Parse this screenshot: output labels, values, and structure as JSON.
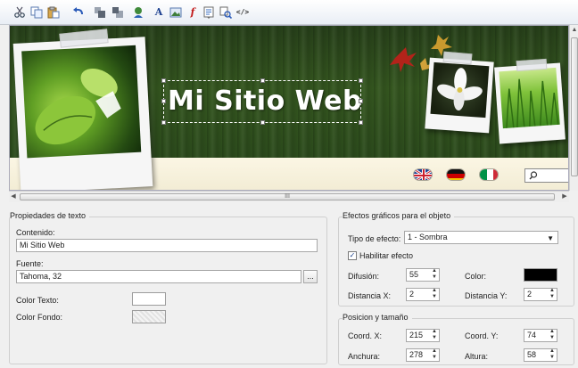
{
  "toolbar": {
    "buttons": [
      {
        "icon": "cut-icon"
      },
      {
        "icon": "copy-icon"
      },
      {
        "icon": "paste-icon"
      },
      {
        "icon": "undo-icon"
      },
      {
        "icon": "bring-forward-icon"
      },
      {
        "icon": "send-backward-icon"
      },
      {
        "icon": "clip-art-icon"
      },
      {
        "icon": "text-icon",
        "glyph": "A"
      },
      {
        "icon": "image-icon"
      },
      {
        "icon": "flash-icon",
        "glyph": "f"
      },
      {
        "icon": "properties-icon"
      },
      {
        "icon": "zoom-icon"
      },
      {
        "icon": "html-code-icon",
        "glyph": "</>"
      }
    ]
  },
  "canvas": {
    "site_title": "Mi Sitio Web",
    "flags": [
      {
        "name": "english",
        "color": "#1f3f8f"
      },
      {
        "name": "german",
        "color": "#cc0000"
      },
      {
        "name": "italian",
        "color": "#009246"
      }
    ],
    "scroll_thumb_glyph": "III"
  },
  "text_properties": {
    "title": "Propiedades de texto",
    "content_label": "Contenido:",
    "content_value": "Mi Sitio Web",
    "font_label": "Fuente:",
    "font_value": "Tahoma, 32",
    "font_button": "...",
    "text_color_label": "Color Texto:",
    "text_color": "#ffffff",
    "bg_color_label": "Color Fondo:"
  },
  "effects": {
    "title": "Efectos gráficos para el objeto",
    "effect_type_label": "Tipo de efecto:",
    "effect_type_value": "1 - Sombra",
    "enable_label": "Habilitar efecto",
    "enable_checked": true,
    "diffusion_label": "Difusión:",
    "diffusion_value": "55",
    "color_label": "Color:",
    "color_value": "#000000",
    "distance_x_label": "Distancia X:",
    "distance_x_value": "2",
    "distance_y_label": "Distancia Y:",
    "distance_y_value": "2"
  },
  "position": {
    "title": "Posicion y tamaño",
    "coord_x_label": "Coord. X:",
    "coord_x_value": "215",
    "coord_y_label": "Coord. Y:",
    "coord_y_value": "74",
    "width_label": "Anchura:",
    "width_value": "278",
    "height_label": "Altura:",
    "height_value": "58"
  }
}
